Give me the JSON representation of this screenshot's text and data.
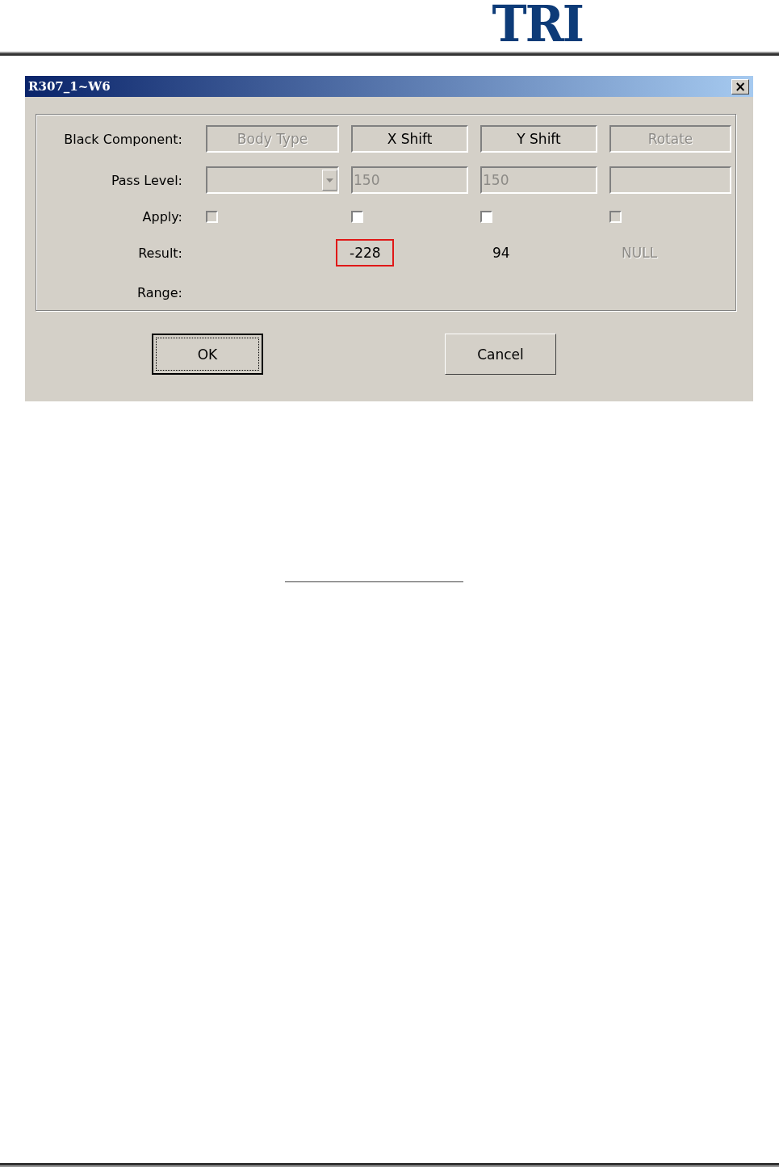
{
  "page_header": {
    "logo": "TRI"
  },
  "window": {
    "title": "R307_1~W6",
    "close": "×"
  },
  "group": {
    "rows": [
      {
        "kind": "headers",
        "label": "Black Component:",
        "cells": [
          {
            "text": "Body Type",
            "disabled": true
          },
          {
            "text": "X Shift",
            "disabled": false
          },
          {
            "text": "Y Shift",
            "disabled": false
          },
          {
            "text": "Rotate",
            "disabled": true
          }
        ]
      },
      {
        "kind": "fields",
        "label": "Pass Level:",
        "cells": [
          {
            "kind": "dropdown",
            "disabled": true
          },
          {
            "kind": "text",
            "value": "150",
            "disabled": true
          },
          {
            "kind": "text",
            "value": "150",
            "disabled": true
          },
          {
            "kind": "text",
            "disabled": true
          }
        ]
      },
      {
        "kind": "checkboxes",
        "label": "Apply:",
        "cells": [
          {
            "checked": false,
            "disabled": true
          },
          {
            "checked": false,
            "disabled": false
          },
          {
            "checked": false,
            "disabled": false
          },
          {
            "checked": false,
            "disabled": true
          }
        ]
      },
      {
        "kind": "results",
        "label": "Result:",
        "cells": [
          null,
          {
            "text": "-228",
            "highlighted": true,
            "disabled": false
          },
          {
            "text": "94",
            "highlighted": false,
            "disabled": false
          },
          {
            "text": "NULL",
            "highlighted": false,
            "disabled": true
          }
        ]
      },
      {
        "kind": "label",
        "label": "Range:"
      }
    ]
  },
  "buttons": [
    {
      "label": "OK",
      "default": true
    },
    {
      "label": "Cancel",
      "default": false
    }
  ]
}
